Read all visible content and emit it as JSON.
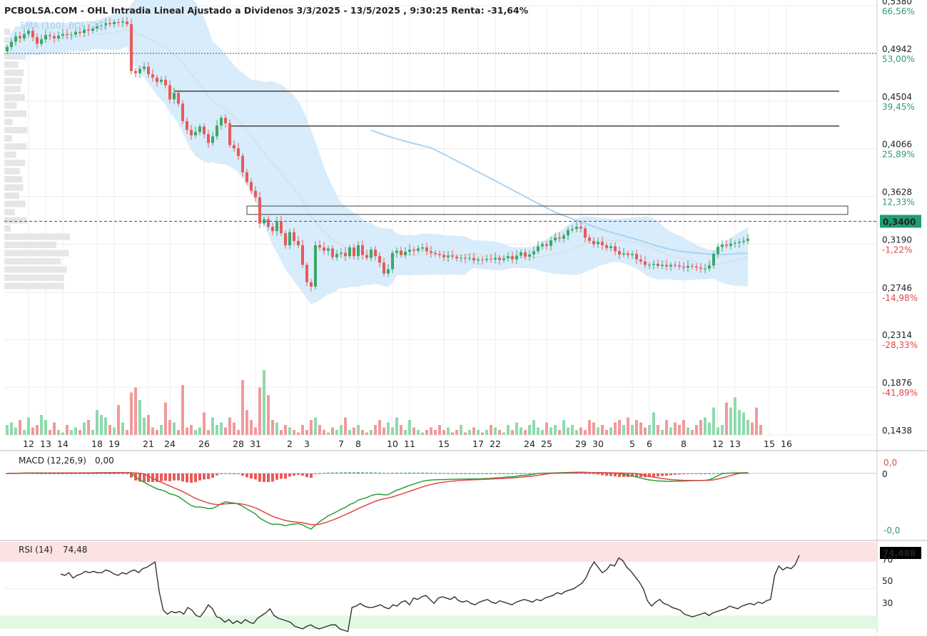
{
  "header": {
    "title": "PCBOLSA.COM - OHL Intradia Lineal Ajustado a Dividenos 3/3/2025 - 13/5/2025 , 9:30:25 Renta: -31,64%"
  },
  "indicator_labels": {
    "sma": "SMA (100)",
    "bol": "BOL (20)"
  },
  "price_axis": {
    "labels": [
      {
        "price": 0.538,
        "text": "0,5380",
        "pct": "66,56%",
        "pct_color": "#2e9e6b"
      },
      {
        "price": 0.4942,
        "text": "0,4942",
        "pct": "53,00%",
        "pct_color": "#2e9e6b"
      },
      {
        "price": 0.4504,
        "text": "0,4504",
        "pct": "39,45%",
        "pct_color": "#2e9e6b"
      },
      {
        "price": 0.4066,
        "text": "0,4066",
        "pct": "25,89%",
        "pct_color": "#2e9e6b"
      },
      {
        "price": 0.3628,
        "text": "0,3628",
        "pct": "12,33%",
        "pct_color": "#2e9e6b"
      },
      {
        "price": 0.319,
        "text": "0,3190",
        "pct": "-1,22%",
        "pct_color": "#e04848"
      },
      {
        "price": 0.2746,
        "text": "0,2746",
        "pct": "-14,98%",
        "pct_color": "#e04848"
      },
      {
        "price": 0.2314,
        "text": "0,2314",
        "pct": "-28,33%",
        "pct_color": "#e04848"
      },
      {
        "price": 0.1876,
        "text": "0,1876",
        "pct": "-41,89%",
        "pct_color": "#e04848"
      },
      {
        "price": 0.1438,
        "text": "0,1438",
        "pct": "",
        "pct_color": "#e04848"
      }
    ],
    "last_price_text": "0,3400"
  },
  "macd_panel": {
    "label": "MACD (12,26,9)",
    "value": "0,00",
    "top_label": "0,0",
    "zero_label": "0",
    "bottom_label": "-0,0"
  },
  "rsi_panel": {
    "label": "RSI (14)",
    "value": "74,48",
    "last_box": "74,488",
    "ticks": [
      "70",
      "50",
      "30"
    ]
  },
  "colors": {
    "up": "#3aa86a",
    "down": "#e85a5a",
    "volume_up": "#8fd9ad",
    "volume_down": "#f19a9a",
    "band": "#d8ecfb",
    "sma": "#a9d4f2",
    "last_price": "#1f9e6e",
    "current_line": "#3b3bc9"
  },
  "chart_data": {
    "type": "candlestick",
    "title": "PCBOLSA.COM - OHL Intradia Lineal Ajustado a Dividenos 3/3/2025 - 13/5/2025 , 9:30:25 Renta: -31,64%",
    "ylim": [
      0.1438,
      0.538
    ],
    "last_price": 0.34,
    "dotted_reference": 0.4942,
    "x_ticks": [
      "12",
      "13",
      "14",
      "18",
      "19",
      "21",
      "24",
      "26",
      "28",
      "31",
      "2",
      "3",
      "7",
      "8",
      "10",
      "11",
      "15",
      "17",
      "22",
      "24",
      "25",
      "29",
      "30",
      "5",
      "6",
      "8",
      "12",
      "13",
      "15",
      "16"
    ],
    "x_tick_index": [
      5,
      9,
      13,
      21,
      25,
      33,
      38,
      46,
      54,
      58,
      66,
      70,
      78,
      82,
      90,
      94,
      102,
      110,
      114,
      122,
      126,
      134,
      138,
      146,
      150,
      158,
      166,
      170,
      178,
      182
    ],
    "levels": [
      {
        "price": 0.4595,
        "from": 39,
        "type": "line"
      },
      {
        "price": 0.4275,
        "from": 52,
        "type": "line"
      },
      {
        "price": 0.3463,
        "from": 56,
        "type": "box",
        "top": 0.354,
        "bottom": 0.3463
      }
    ],
    "close": [
      0.5,
      0.505,
      0.51,
      0.508,
      0.512,
      0.515,
      0.509,
      0.503,
      0.507,
      0.511,
      0.51,
      0.508,
      0.5105,
      0.512,
      0.511,
      0.5115,
      0.514,
      0.513,
      0.516,
      0.515,
      0.517,
      0.519,
      0.52,
      0.522,
      0.521,
      0.523,
      0.5225,
      0.5235,
      0.521,
      0.478,
      0.476,
      0.48,
      0.482,
      0.475,
      0.472,
      0.468,
      0.47,
      0.465,
      0.452,
      0.458,
      0.448,
      0.432,
      0.424,
      0.419,
      0.422,
      0.427,
      0.42,
      0.412,
      0.418,
      0.428,
      0.435,
      0.43,
      0.41,
      0.407,
      0.4,
      0.385,
      0.376,
      0.368,
      0.362,
      0.338,
      0.342,
      0.335,
      0.331,
      0.34,
      0.329,
      0.318,
      0.33,
      0.322,
      0.318,
      0.3,
      0.284,
      0.28,
      0.318,
      0.316,
      0.313,
      0.315,
      0.307,
      0.31,
      0.311,
      0.308,
      0.316,
      0.308,
      0.318,
      0.309,
      0.3065,
      0.314,
      0.308,
      0.302,
      0.292,
      0.296,
      0.311,
      0.313,
      0.309,
      0.312,
      0.314,
      0.313,
      0.315,
      0.316,
      0.3125,
      0.311,
      0.31,
      0.309,
      0.307,
      0.3085,
      0.3075,
      0.306,
      0.3065,
      0.3058,
      0.3063,
      0.304,
      0.305,
      0.3045,
      0.3055,
      0.305,
      0.3065,
      0.3045,
      0.306,
      0.308,
      0.305,
      0.3085,
      0.3115,
      0.3075,
      0.3095,
      0.3125,
      0.317,
      0.319,
      0.3175,
      0.3225,
      0.325,
      0.324,
      0.327,
      0.332,
      0.333,
      0.335,
      0.3335,
      0.325,
      0.322,
      0.319,
      0.321,
      0.318,
      0.3155,
      0.317,
      0.3125,
      0.3095,
      0.3105,
      0.309,
      0.31,
      0.305,
      0.303,
      0.3,
      0.3,
      0.301,
      0.299,
      0.3,
      0.2985,
      0.3,
      0.2995,
      0.2985,
      0.2975,
      0.299,
      0.2985,
      0.2975,
      0.2965,
      0.2965,
      0.2995,
      0.31,
      0.3165,
      0.3185,
      0.3175,
      0.3195,
      0.32,
      0.321,
      0.322,
      0.324
    ],
    "volume": [
      0.2,
      0.25,
      0.15,
      0.3,
      0.1,
      0.35,
      0.15,
      0.2,
      0.4,
      0.3,
      0.1,
      0.25,
      0.1,
      0.05,
      0.2,
      0.1,
      0.15,
      0.1,
      0.25,
      0.3,
      0.1,
      0.5,
      0.4,
      0.35,
      0.2,
      0.15,
      0.6,
      0.25,
      0.1,
      0.85,
      0.95,
      0.7,
      0.35,
      0.4,
      0.15,
      0.1,
      0.2,
      0.65,
      0.3,
      0.25,
      0.1,
      1.0,
      0.15,
      0.2,
      0.1,
      0.15,
      0.45,
      0.1,
      0.35,
      0.2,
      0.25,
      0.15,
      0.35,
      0.25,
      0.1,
      1.1,
      0.5,
      0.3,
      0.15,
      0.95,
      1.3,
      0.8,
      0.3,
      0.25,
      0.1,
      0.2,
      0.15,
      0.1,
      0.05,
      0.2,
      0.1,
      0.3,
      0.35,
      0.2,
      0.1,
      0.05,
      0.15,
      0.1,
      0.2,
      0.35,
      0.1,
      0.15,
      0.2,
      0.1,
      0.05,
      0.1,
      0.2,
      0.3,
      0.15,
      0.25,
      0.15,
      0.35,
      0.2,
      0.1,
      0.3,
      0.15,
      0.1,
      0.05,
      0.1,
      0.15,
      0.1,
      0.2,
      0.1,
      0.15,
      0.05,
      0.1,
      0.2,
      0.05,
      0.1,
      0.15,
      0.1,
      0.05,
      0.1,
      0.2,
      0.15,
      0.1,
      0.05,
      0.2,
      0.1,
      0.25,
      0.15,
      0.1,
      0.2,
      0.3,
      0.15,
      0.1,
      0.25,
      0.15,
      0.2,
      0.1,
      0.3,
      0.15,
      0.2,
      0.1,
      0.15,
      0.1,
      0.3,
      0.25,
      0.15,
      0.2,
      0.1,
      0.15,
      0.25,
      0.3,
      0.2,
      0.35,
      0.2,
      0.3,
      0.25,
      0.15,
      0.2,
      0.45,
      0.2,
      0.1,
      0.3,
      0.15,
      0.25,
      0.2,
      0.3,
      0.15,
      0.1,
      0.2,
      0.3,
      0.35,
      0.25,
      0.55,
      0.15,
      0.2,
      0.65,
      0.55,
      0.75,
      0.5,
      0.45,
      0.3,
      0.25,
      0.55,
      0.2
    ],
    "macd_range": [
      -1.0,
      0.3
    ],
    "rsi_ylim": [
      20,
      85
    ],
    "rsi": [
      61,
      60,
      62,
      58,
      60,
      61,
      63,
      62,
      63,
      62,
      62,
      64,
      63,
      61,
      60,
      62,
      61,
      63,
      64,
      62,
      65,
      66,
      68,
      70,
      48,
      34,
      31,
      33,
      32,
      33,
      31,
      36,
      34,
      30,
      29,
      33,
      38,
      35,
      29,
      28,
      25,
      27,
      24,
      26,
      24,
      27,
      25,
      24,
      28,
      30,
      32,
      35,
      30,
      28,
      27,
      26,
      25,
      22,
      21,
      20,
      22,
      23,
      21,
      20,
      21,
      22,
      23,
      23,
      20,
      19,
      18,
      36,
      37,
      39,
      37,
      36,
      36,
      37,
      38,
      36,
      35,
      38,
      37,
      40,
      41,
      38,
      43,
      42,
      44,
      45,
      42,
      39,
      43,
      44,
      43,
      42,
      44,
      41,
      40,
      41,
      39,
      38,
      40,
      41,
      42,
      40,
      39,
      41,
      40,
      39,
      38,
      40,
      41,
      42,
      41,
      40,
      42,
      41,
      43,
      44,
      45,
      47,
      46,
      48,
      49,
      50,
      52,
      54,
      58,
      65,
      70,
      66,
      62,
      64,
      68,
      67,
      73,
      71,
      66,
      63,
      59,
      55,
      50,
      41,
      37,
      40,
      42,
      39,
      38,
      36,
      35,
      34,
      31,
      30,
      29,
      30,
      31,
      32,
      30,
      32,
      33,
      34,
      35,
      37,
      36,
      35,
      37,
      38,
      39,
      38,
      40,
      39,
      41,
      42,
      60,
      67,
      64,
      66,
      65,
      68,
      75
    ]
  }
}
